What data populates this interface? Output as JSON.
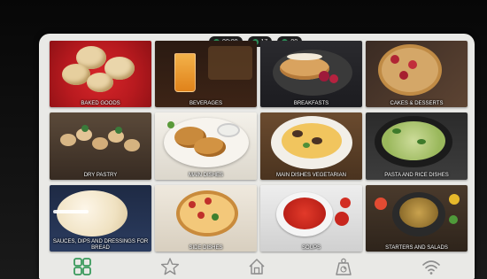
{
  "status": {
    "time": "00:00",
    "count": "17",
    "level": "00"
  },
  "categories": [
    {
      "label": "BAKED GOODS"
    },
    {
      "label": "BEVERAGES"
    },
    {
      "label": "BREAKFASTS"
    },
    {
      "label": "CAKES & DESSERTS"
    },
    {
      "label": "DRY PASTRY"
    },
    {
      "label": "MAIN DISHES"
    },
    {
      "label": "MAIN DISHES VEGETARIAN"
    },
    {
      "label": "PASTA and RICE DISHES"
    },
    {
      "label": "SAUCES, DIPS and DRESSINGS FOR BREAD"
    },
    {
      "label": "SIDE DISHES"
    },
    {
      "label": "SOUPS"
    },
    {
      "label": "STARTERS and SALADS"
    }
  ],
  "nav": {
    "items": [
      {
        "icon": "grid-icon",
        "active": true
      },
      {
        "icon": "star-icon",
        "active": false
      },
      {
        "icon": "home-icon",
        "active": false
      },
      {
        "icon": "scale-icon",
        "active": false
      },
      {
        "icon": "wifi-icon",
        "active": false
      }
    ]
  },
  "colors": {
    "active": "#3a9a5c",
    "inactive": "#9a9a9a",
    "screen": "#e9e9e6",
    "label_text": "#ffffff"
  }
}
